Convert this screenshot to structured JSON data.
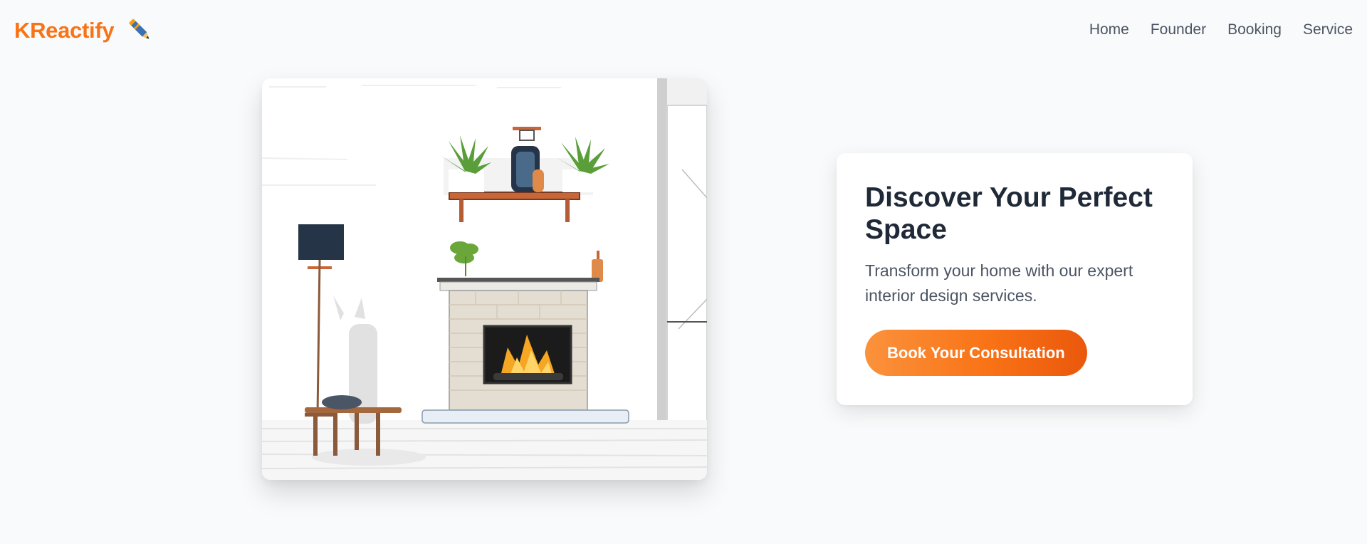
{
  "brand": {
    "name": "KReactify",
    "icon": "pen-icon",
    "color": "#f97316"
  },
  "nav": {
    "items": [
      "Home",
      "Founder",
      "Booking",
      "Service"
    ]
  },
  "hero": {
    "image": {
      "subject": "living-room-fireplace-illustration"
    },
    "title": "Discover Your Perfect Space",
    "subtitle": "Transform your home with our expert interior design services.",
    "cta_label": "Book Your Consultation"
  },
  "colors": {
    "accent": "#f97316",
    "heading": "#1f2937",
    "body_text": "#4b5563",
    "background": "#f9fafb"
  }
}
